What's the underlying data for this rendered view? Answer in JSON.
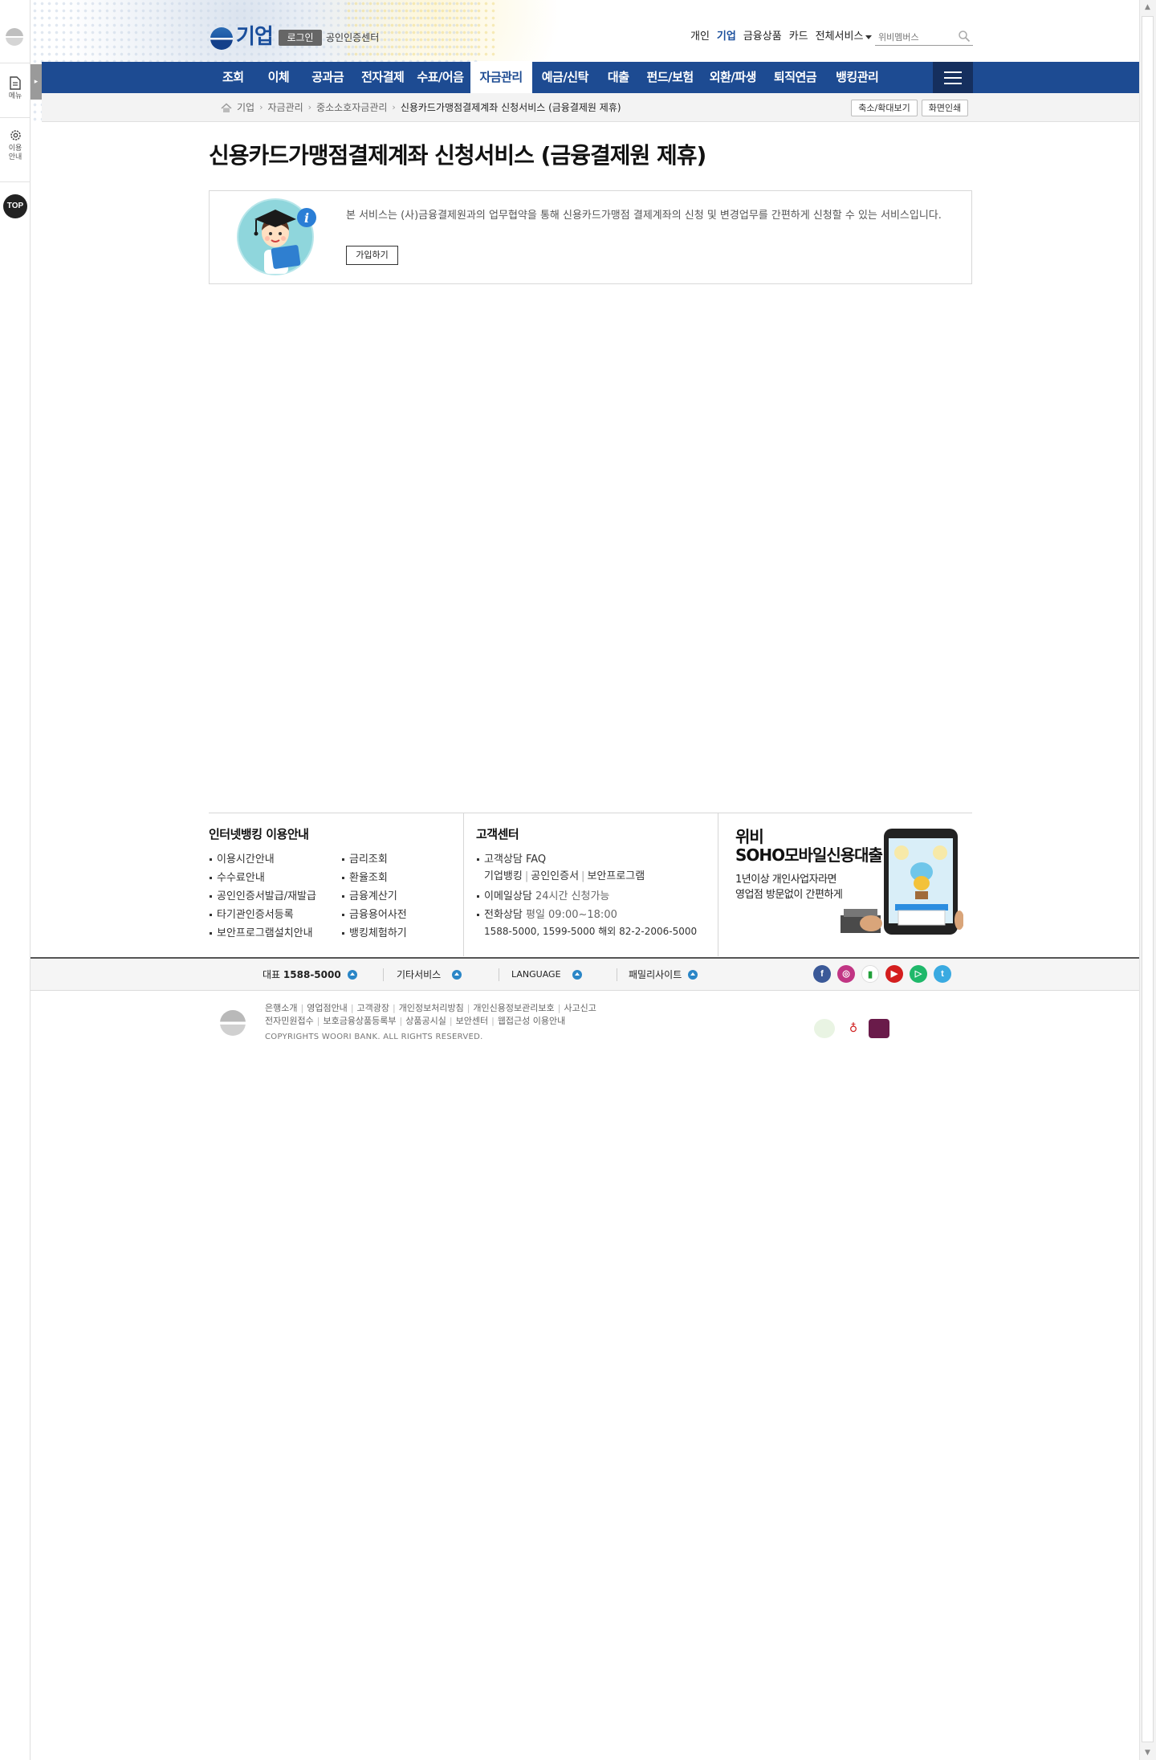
{
  "quickbar": {
    "menu_label": "메뉴",
    "guide_label_1": "이용",
    "guide_label_2": "안내",
    "top_label": "TOP"
  },
  "header": {
    "logo_text": "기업",
    "login_label": "로그인",
    "cert_center": "공인인증센터",
    "top_links": [
      "개인",
      "기업",
      "금융상품",
      "카드"
    ],
    "all_services": "전체서비스",
    "search_placeholder": "위비멤버스"
  },
  "nav": {
    "items": [
      "조회",
      "이체",
      "공과금",
      "전자결제",
      "수표/어음",
      "자금관리",
      "예금/신탁",
      "대출",
      "펀드/보험",
      "외환/파생",
      "퇴직연금",
      "뱅킹관리"
    ]
  },
  "breadcrumb": {
    "items": [
      "기업",
      "자금관리",
      "중소소호자금관리"
    ],
    "current": "신용카드가맹점결제계좌 신청서비스 (금융결제원 제휴)",
    "zoom_button": "축소/확대보기",
    "print_button": "화면인쇄"
  },
  "page": {
    "title": "신용카드가맹점결제계좌 신청서비스 (금융결제원 제휴)",
    "info_text": "본 서비스는 (사)금융결제원과의 업무협약을 통해 신용카드가맹점 결제계좌의 신청 및 변경업무를 간편하게 신청할 수 있는 서비스입니다.",
    "join_button": "가입하기"
  },
  "footer": {
    "guide": {
      "heading": "인터넷뱅킹 이용안내",
      "col1": [
        "이용시간안내",
        "수수료안내",
        "공인인증서발급/재발급",
        "타기관인증서등록",
        "보안프로그램설치안내"
      ],
      "col2": [
        "금리조회",
        "환율조회",
        "금융계산기",
        "금융용어사전",
        "뱅킹체험하기"
      ]
    },
    "customer": {
      "heading": "고객센터",
      "faq": "고객상담 FAQ",
      "faq_sub": [
        "기업뱅킹",
        "공인인증서",
        "보안프로그램"
      ],
      "email": "이메일상담",
      "email_note": "24시간 신청가능",
      "phone": "전화상담",
      "phone_hours": "평일 09:00~18:00",
      "phone_numbers": "1588-5000, 1599-5000 해외 82-2-2006-5000"
    },
    "banner": {
      "title_line1": "위비",
      "title_line2": "SOHO모바일신용대출",
      "desc_line1": "1년이상 개인사업자라면",
      "desc_line2": "영업점 방문없이 간편하게"
    },
    "bar": {
      "main_label": "대표",
      "main_number": "1588-5000",
      "other_services": "기타서비스",
      "language": "LANGUAGE",
      "family_sites": "패밀리사이트"
    },
    "links_row1": [
      "은행소개",
      "영업점안내",
      "고객광장",
      "개인정보처리방침",
      "개인신용정보관리보호",
      "사고신고"
    ],
    "links_row2": [
      "전자민원접수",
      "보호금융상품등록부",
      "상품공시실",
      "보안센터",
      "웹접근성 이용안내"
    ],
    "copyright": "COPYRIGHTS WOORI BANK. ALL RIGHTS RESERVED."
  },
  "colors": {
    "nav_blue": "#1d4b92",
    "brand_blue": "#1b4f9c",
    "accent_blue": "#2a86c7"
  }
}
